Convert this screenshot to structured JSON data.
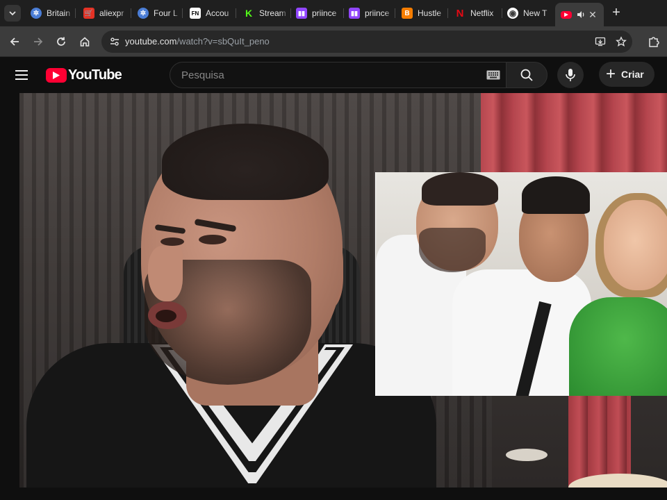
{
  "browser": {
    "tabs": [
      {
        "title": "Britain",
        "favicon_color": "#4a7dd6",
        "icon": "globe-icon"
      },
      {
        "title": "aliexpr",
        "favicon_color": "#e43225",
        "icon": "aliexpress-icon"
      },
      {
        "title": "Four L",
        "favicon_color": "#4a7dd6",
        "icon": "globe-icon"
      },
      {
        "title": "Accou",
        "favicon_color": "#ffffff",
        "icon": "fn-icon"
      },
      {
        "title": "Stream",
        "favicon_color": "#53fc18",
        "icon": "kick-icon"
      },
      {
        "title": "priince",
        "favicon_color": "#9146ff",
        "icon": "twitch-icon"
      },
      {
        "title": "priince",
        "favicon_color": "#9146ff",
        "icon": "twitch-icon"
      },
      {
        "title": "Hustle",
        "favicon_color": "#f57d00",
        "icon": "blogger-icon"
      },
      {
        "title": "Netflix",
        "favicon_color": "#e50914",
        "icon": "netflix-icon"
      },
      {
        "title": "New T",
        "favicon_color": "#ffffff",
        "icon": "chrome-icon"
      }
    ],
    "active_tab": {
      "icon": "youtube-icon",
      "audio_icon": "speaker-icon",
      "close": "✕"
    },
    "new_tab_label": "+",
    "url_host": "youtube.com",
    "url_path": "/watch?v=sbQuIt_peno"
  },
  "youtube": {
    "logo_text": "YouTube",
    "search_placeholder": "Pesquisa",
    "create_label": "Criar",
    "colors": {
      "brand_red": "#ff0033",
      "background": "#0f0f0f"
    }
  }
}
